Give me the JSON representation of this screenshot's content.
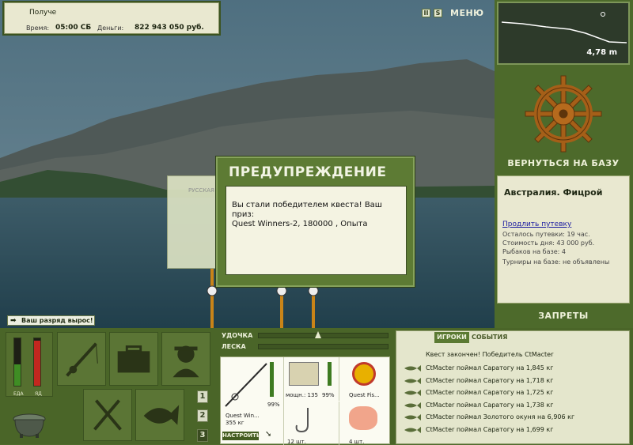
{
  "info": {
    "location": "Получе",
    "time_label": "Время:",
    "time_value": "05:00 СБ",
    "money_label": "Деньги:",
    "money_value": "822 943 050 руб."
  },
  "top": {
    "pause_icon": "pause-icon",
    "s_icon": "s-icon",
    "menu_label": "МЕНЮ"
  },
  "depth": {
    "value": "4,78 m"
  },
  "base": {
    "back_label": "ВЕРНУТЬСЯ НА БАЗУ",
    "title": "Австралия. Фицрой",
    "renew_label": "Продлить путевку",
    "left": "Осталось путевки: 19 час.",
    "cost": "Стоимость дня: 43 000 руб.",
    "fishers": "Рыбаков на базе: 4",
    "tournaments": "Турниры на базе: не объявлены",
    "bans_label": "ЗАПРЕТЫ"
  },
  "toast": {
    "text": "Ваш разряд вырос!"
  },
  "bg_dialog": {
    "label": "РУССКАЯ"
  },
  "dialog": {
    "title": "ПРЕДУПРЕЖДЕНИЕ",
    "line1": "Вы стали победителем квеста! Ваш приз:",
    "line2": "Quest Winners-2, 180000 , Опыта"
  },
  "gauges": {
    "food_label": "ЕДА",
    "bait_label": "ЯД",
    "food_level": 0.45,
    "bait_level": 0.95
  },
  "pages": [
    "1",
    "2",
    "3"
  ],
  "rod": {
    "rod_label": "УДОЧКА",
    "line_label": "ЛЕСКА"
  },
  "gear": {
    "rod_name": "Quest Win...",
    "rod_weight": "355 кг",
    "rod_pct": "99%",
    "reel_label": "мощн.: 135",
    "reel_pct": "99%",
    "line_name": "Quest Fis...",
    "hook_qty": "12 шт.",
    "bait_qty": "4 шт.",
    "setup_label": "НАСТРОИТЬ"
  },
  "events": {
    "tab_players": "ИГРОКИ",
    "tab_events": "СОБЫТИЯ",
    "header": "Квест закончен! Победитель CtMacter",
    "items": [
      "CtMacter поймал Саратогу на 1,845 кг",
      "CtMacter поймал Саратогу на 1,718 кг",
      "CtMacter поймал Саратогу на 1,725 кг",
      "CtMacter поймал Саратогу на 1,738 кг",
      "CtMacter поймал Золотого окуня на 6,906 кг",
      "CtMacter поймал Саратогу на 1,699 кг"
    ]
  }
}
